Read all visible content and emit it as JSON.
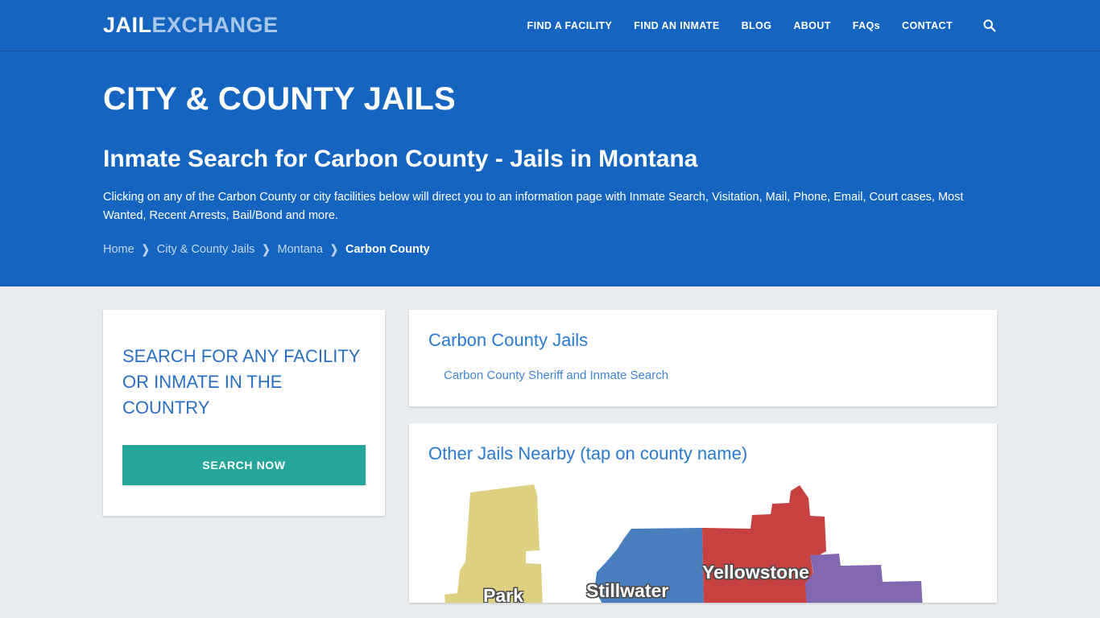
{
  "site": {
    "logo_primary": "JAIL",
    "logo_secondary": "EXCHANGE"
  },
  "nav": {
    "items": [
      {
        "label": "FIND A FACILITY"
      },
      {
        "label": "FIND AN INMATE"
      },
      {
        "label": "BLOG"
      },
      {
        "label": "ABOUT"
      },
      {
        "label": "FAQs"
      },
      {
        "label": "CONTACT"
      }
    ],
    "search_icon": "search-icon"
  },
  "hero": {
    "title": "CITY & COUNTY JAILS",
    "subtitle": "Inmate Search for Carbon County - Jails in Montana",
    "description": "Clicking on any of the Carbon County or city facilities below will direct you to an information page with Inmate Search, Visitation, Mail, Phone, Email, Court cases, Most Wanted, Recent Arrests, Bail/Bond and more.",
    "breadcrumb": [
      {
        "label": "Home",
        "current": false
      },
      {
        "label": "City & County Jails",
        "current": false
      },
      {
        "label": "Montana",
        "current": false
      },
      {
        "label": "Carbon County",
        "current": true
      }
    ],
    "breadcrumb_separator": "❯"
  },
  "sidebar": {
    "search_card": {
      "title": "SEARCH FOR ANY FACILITY OR INMATE IN THE COUNTRY",
      "button_label": "SEARCH NOW"
    }
  },
  "main": {
    "jails_card": {
      "heading": "Carbon County Jails",
      "links": [
        {
          "label": "Carbon County Sheriff and Inmate Search"
        }
      ]
    },
    "nearby_card": {
      "heading": "Other Jails Nearby (tap on county name)",
      "map": {
        "counties": [
          {
            "name": "Park",
            "color": "#ddd080"
          },
          {
            "name": "Stillwater",
            "color": "#4a7fbf"
          },
          {
            "name": "Yellowstone",
            "color": "#c6413f"
          },
          {
            "name": "",
            "color": "#8268b0"
          }
        ]
      }
    }
  },
  "colors": {
    "brand_blue": "#1565c0",
    "page_background": "#eaedef",
    "accent_teal": "#26a69a",
    "link_blue": "#3f86d6",
    "heading_blue": "#2a7ad2"
  }
}
